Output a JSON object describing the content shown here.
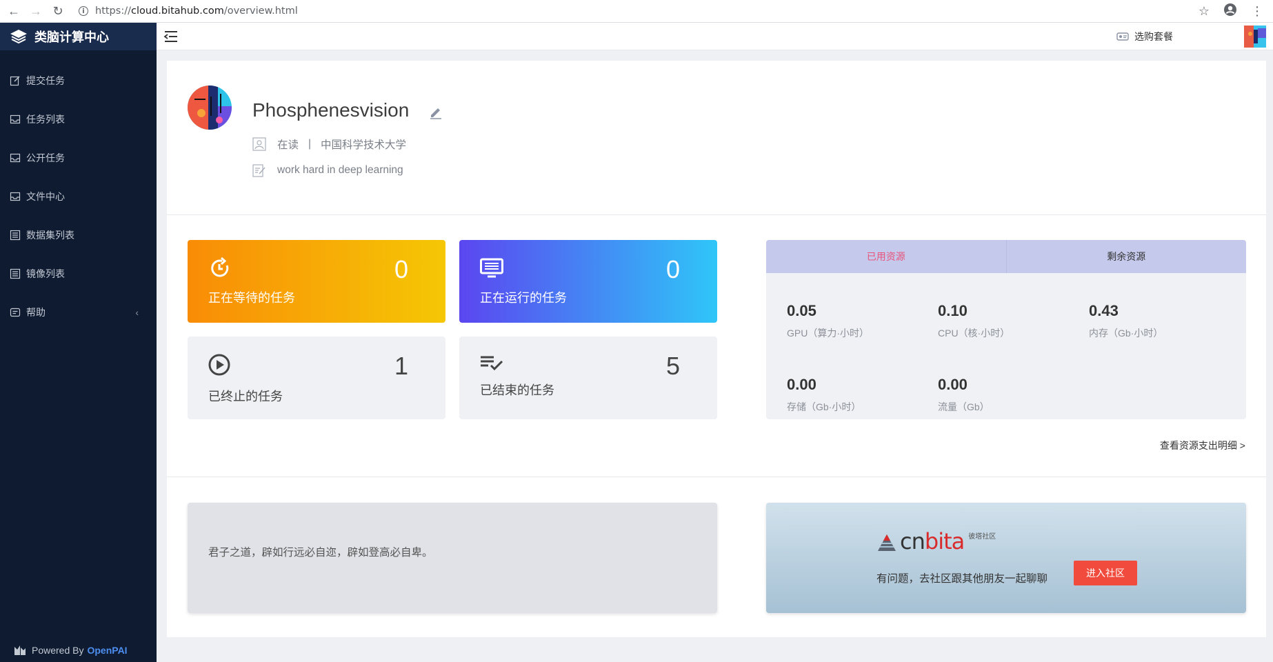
{
  "browser": {
    "url_prefix": "https://",
    "url_host": "cloud.bitahub.com",
    "url_path": "/overview.html"
  },
  "sidebar": {
    "brand": "类脑计算中心",
    "items": [
      {
        "label": "提交任务",
        "icon": "edit-icon"
      },
      {
        "label": "任务列表",
        "icon": "inbox-icon"
      },
      {
        "label": "公开任务",
        "icon": "inbox-icon"
      },
      {
        "label": "文件中心",
        "icon": "inbox-icon"
      },
      {
        "label": "数据集列表",
        "icon": "list-icon"
      },
      {
        "label": "镜像列表",
        "icon": "list-icon"
      },
      {
        "label": "帮助",
        "icon": "help-icon",
        "chevron": "‹"
      }
    ],
    "powered_by": "Powered By",
    "powered_name": "OpenPAI"
  },
  "header": {
    "plan_label": "选购套餐"
  },
  "profile": {
    "name": "Phosphenesvision",
    "status": "在读",
    "separator": "|",
    "school": "中国科学技术大学",
    "bio": "work hard in deep learning"
  },
  "stats": {
    "waiting": {
      "value": "0",
      "label": "正在等待的任务"
    },
    "running": {
      "value": "0",
      "label": "正在运行的任务"
    },
    "stopped": {
      "value": "1",
      "label": "已终止的任务"
    },
    "finished": {
      "value": "5",
      "label": "已结束的任务"
    }
  },
  "resources": {
    "tabs": [
      "已用资源",
      "剩余资源"
    ],
    "active_tab": "已用资源",
    "items": [
      {
        "value": "0.05",
        "label": "GPU（算力·小时）"
      },
      {
        "value": "0.10",
        "label": "CPU（核·小时）"
      },
      {
        "value": "0.43",
        "label": "内存（Gb·小时）"
      },
      {
        "value": "0.00",
        "label": "存储（Gb·小时）"
      },
      {
        "value": "0.00",
        "label": "流量（Gb）"
      }
    ],
    "detail_link": "查看资源支出明细 >"
  },
  "quote": {
    "text": "君子之道，辟如行远必自迩，辟如登高必自卑。"
  },
  "community": {
    "logo_cn": "cn",
    "logo_bita": "bita",
    "logo_tag": "彼塔社区",
    "text": "有问题，去社区跟其他朋友一起聊聊",
    "button": "进入社区"
  },
  "colors": {
    "sidebar_bg": "#0f1b31",
    "brand_bg": "#1a2c4e",
    "waiting_gradient": [
      "#f98c06",
      "#f5c705"
    ],
    "running_gradient": [
      "#5b46f0",
      "#2fc6f8"
    ],
    "active_tab": "#e8537a",
    "community_button": "#f04b3c",
    "openpai": "#4d8ef0"
  }
}
